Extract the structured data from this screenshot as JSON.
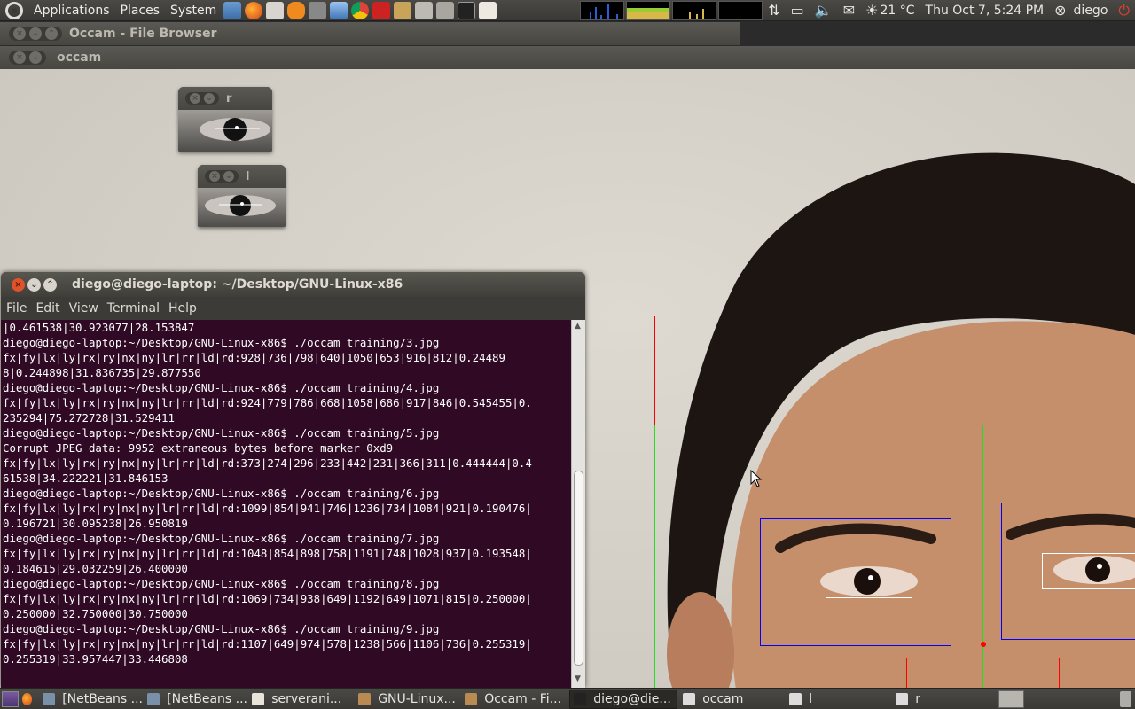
{
  "top_panel": {
    "menus": [
      "Applications",
      "Places",
      "System"
    ],
    "weather": "21 °C",
    "clock": "Thu Oct  7,  5:24 PM",
    "user": "diego"
  },
  "windows": {
    "file_browser_title": "Occam - File Browser",
    "occam_title": "occam",
    "eye_right_title": "r",
    "eye_left_title": "l"
  },
  "terminal": {
    "title": "diego@diego-laptop: ~/Desktop/GNU-Linux-x86",
    "menu": [
      "File",
      "Edit",
      "View",
      "Terminal",
      "Help"
    ],
    "lines": [
      "|0.461538|30.923077|28.153847",
      "diego@diego-laptop:~/Desktop/GNU-Linux-x86$ ./occam training/3.jpg",
      "fx|fy|lx|ly|rx|ry|nx|ny|lr|rr|ld|rd:928|736|798|640|1050|653|916|812|0.24489",
      "8|0.244898|31.836735|29.877550",
      "diego@diego-laptop:~/Desktop/GNU-Linux-x86$ ./occam training/4.jpg",
      "fx|fy|lx|ly|rx|ry|nx|ny|lr|rr|ld|rd:924|779|786|668|1058|686|917|846|0.545455|0.",
      "235294|75.272728|31.529411",
      "diego@diego-laptop:~/Desktop/GNU-Linux-x86$ ./occam training/5.jpg",
      "Corrupt JPEG data: 9952 extraneous bytes before marker 0xd9",
      "fx|fy|lx|ly|rx|ry|nx|ny|lr|rr|ld|rd:373|274|296|233|442|231|366|311|0.444444|0.4",
      "61538|34.222221|31.846153",
      "diego@diego-laptop:~/Desktop/GNU-Linux-x86$ ./occam training/6.jpg",
      "fx|fy|lx|ly|rx|ry|nx|ny|lr|rr|ld|rd:1099|854|941|746|1236|734|1084|921|0.190476|",
      "0.196721|30.095238|26.950819",
      "diego@diego-laptop:~/Desktop/GNU-Linux-x86$ ./occam training/7.jpg",
      "fx|fy|lx|ly|rx|ry|nx|ny|lr|rr|ld|rd:1048|854|898|758|1191|748|1028|937|0.193548|",
      "0.184615|29.032259|26.400000",
      "diego@diego-laptop:~/Desktop/GNU-Linux-x86$ ./occam training/8.jpg",
      "fx|fy|lx|ly|rx|ry|nx|ny|lr|rr|ld|rd:1069|734|938|649|1192|649|1071|815|0.250000|",
      "0.250000|32.750000|30.750000",
      "diego@diego-laptop:~/Desktop/GNU-Linux-x86$ ./occam training/9.jpg",
      "fx|fy|lx|ly|rx|ry|nx|ny|lr|rr|ld|rd:1107|649|974|578|1238|566|1106|736|0.255319|",
      "0.255319|33.957447|33.446808"
    ]
  },
  "taskbar": [
    {
      "label": "[NetBeans ...",
      "icon": "netbeans-icon",
      "active": false
    },
    {
      "label": "[NetBeans ...",
      "icon": "netbeans-icon",
      "active": false
    },
    {
      "label": "serverani...",
      "icon": "text-editor-icon",
      "active": false
    },
    {
      "label": "GNU-Linux...",
      "icon": "folder-icon",
      "active": false
    },
    {
      "label": "Occam - Fi...",
      "icon": "folder-icon",
      "active": false
    },
    {
      "label": "diego@die...",
      "icon": "terminal-icon",
      "active": true
    },
    {
      "label": "occam",
      "icon": "window-icon",
      "active": false
    },
    {
      "label": "l",
      "icon": "window-icon",
      "active": false
    },
    {
      "label": "r",
      "icon": "window-icon",
      "active": false
    }
  ],
  "colors": {
    "terminal_bg": "#300a24",
    "panel_bg": "#3a3935",
    "face_box": "#ff0000",
    "eye_region": "#0000ff",
    "split_line": "#00ff00"
  }
}
